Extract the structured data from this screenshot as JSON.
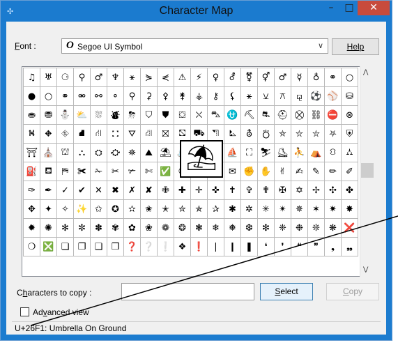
{
  "window": {
    "title": "Character Map",
    "minimize_glyph": "–",
    "maximize_glyph": "□",
    "close_glyph": "✕"
  },
  "font_row": {
    "label_prefix": "F",
    "label_rest": "ont :",
    "selected_font": "Segoe UI Symbol",
    "font_icon_glyph": "O",
    "help_label": "Help"
  },
  "grid": {
    "rows": [
      [
        "♫",
        "♅",
        "⚆",
        "⚲",
        "♂",
        "♆",
        "⚹",
        "⋟",
        "⋞",
        "⚠",
        "⚡",
        "♀",
        "⚦",
        "⚧",
        "⚥",
        "♂",
        "☿",
        "♁",
        "⚭",
        "○"
      ],
      [
        "●",
        "○",
        "⚭",
        "⚮",
        "⚯",
        "⚬",
        "⚲",
        "⚳",
        "⚴",
        "⚵",
        "⚶",
        "⚷",
        "⚸",
        "⚹",
        "⚺",
        "⚻",
        "⚼",
        "⚽",
        "⚾",
        "⛁"
      ],
      [
        "⛂",
        "⛃",
        "⛄",
        "⛅",
        "⛆",
        "⛇",
        "⛈",
        "⛉",
        "⛊",
        "⛋",
        "⛌",
        "⛍",
        "⛎",
        "⛏",
        "⛐",
        "⛑",
        "⛒",
        "⛓",
        "⛔",
        "⊗"
      ],
      [
        "⛕",
        "⛖",
        "⛗",
        "⛘",
        "⛙",
        "⛚",
        "⛛",
        "⛜",
        "⛝",
        "⛞",
        "⛟",
        "⛠",
        "⛡",
        "⛢",
        "⛣",
        "⛤",
        "⛥",
        "⛦",
        "⛧",
        "⛨"
      ],
      [
        "⛩",
        "⛪",
        "⛫",
        "⛬",
        "⛭",
        "⛮",
        "⛯",
        "⛰",
        "⛱",
        "⛲",
        "⛳",
        "⛴",
        "⛵",
        "⛶",
        "⛷",
        "⛸",
        "⛹",
        "⛺",
        "⛻",
        "⛼"
      ],
      [
        "⛽",
        "⛾",
        "⛿",
        "✀",
        "✁",
        "✂",
        "✃",
        "✄",
        "✅",
        "✆",
        "✇",
        "✈",
        "✉",
        "✊",
        "✋",
        "✌",
        "✍",
        "✎",
        "✏",
        "✐"
      ],
      [
        "✑",
        "✒",
        "✓",
        "✔",
        "✕",
        "✖",
        "✗",
        "✘",
        "✙",
        "✚",
        "✛",
        "✜",
        "✝",
        "✞",
        "✟",
        "✠",
        "✡",
        "✢",
        "✣",
        "✤"
      ],
      [
        "✥",
        "✦",
        "✧",
        "✨",
        "✩",
        "✪",
        "✫",
        "✬",
        "✭",
        "✮",
        "✯",
        "✰",
        "✱",
        "✲",
        "✳",
        "✴",
        "✵",
        "✶",
        "✷",
        "✸"
      ],
      [
        "✹",
        "✺",
        "✻",
        "✼",
        "✽",
        "✾",
        "✿",
        "❀",
        "❁",
        "❂",
        "❃",
        "❄",
        "❅",
        "❆",
        "❇",
        "❈",
        "❉",
        "❊",
        "❋",
        "❌"
      ],
      [
        "❍",
        "❎",
        "❏",
        "❐",
        "❑",
        "❒",
        "❓",
        "❔",
        "❕",
        "❖",
        "❗",
        "❘",
        "❙",
        "❚",
        "❛",
        "❜",
        "❝",
        "❞",
        "❟",
        "❠"
      ]
    ],
    "magnified_char": "⛱"
  },
  "copy_row": {
    "label_prefix": "C",
    "label_u": "h",
    "label_rest": "aracters to copy :",
    "value": "",
    "select_prefix": "",
    "select_u": "S",
    "select_rest": "elect",
    "copy_prefix": "",
    "copy_u": "C",
    "copy_rest": "opy"
  },
  "advanced": {
    "label_prefix": "Ad",
    "label_u": "v",
    "label_rest": "anced view",
    "checked": false
  },
  "status_bar": {
    "text": "U+26F1: Umbrella On Ground"
  },
  "colors": {
    "titlebar": "#1b7bcf",
    "close_button": "#c84b3c"
  }
}
